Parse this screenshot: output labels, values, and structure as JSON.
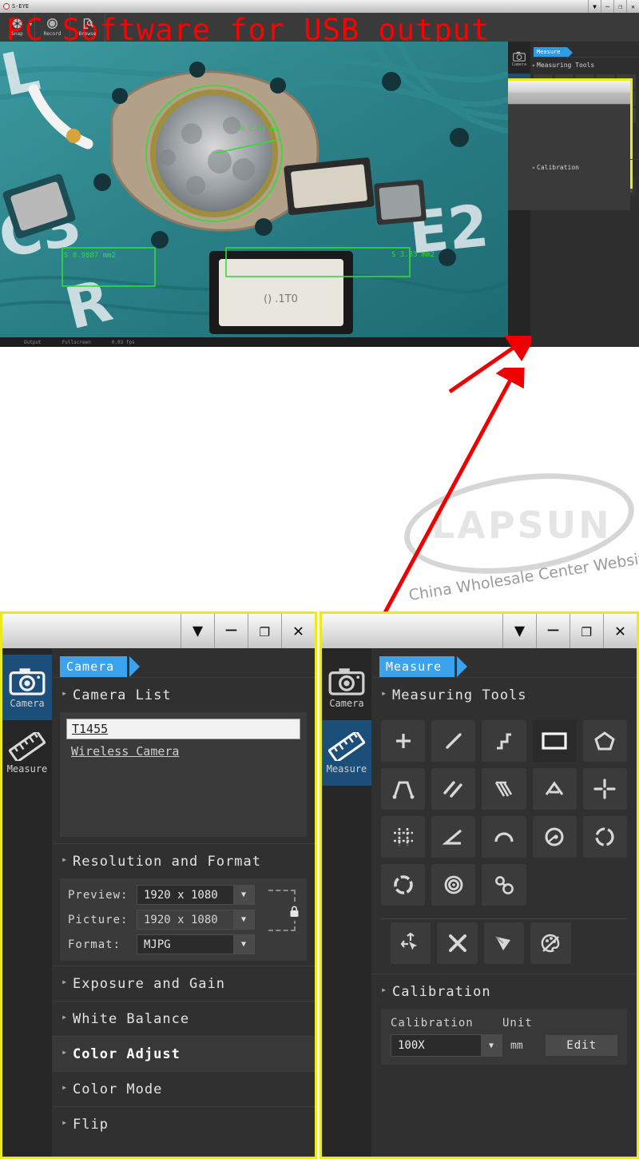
{
  "headline": "PC Software for USB output",
  "app": {
    "name": "S-EYE"
  },
  "top_toolbar": {
    "items": [
      {
        "label": "Snap",
        "icon": "aperture-icon",
        "has_dropdown": true
      },
      {
        "label": "Record",
        "icon": "record-icon",
        "has_dropdown": false
      },
      {
        "label": "Browse",
        "icon": "browse-icon",
        "has_dropdown": false
      }
    ]
  },
  "window_controls": {
    "dropdown": "▼",
    "minimize": "─",
    "restore": "❐",
    "close": "✕"
  },
  "middle_window": {
    "title": "S-EYE",
    "status": {
      "left": "Output",
      "mode": "Fullscreen",
      "fps": "0.03 fps"
    },
    "annotations": [
      {
        "text": "R 1.13 mm",
        "type": "radius"
      },
      {
        "text": "S 0.9887 mm2",
        "type": "area"
      },
      {
        "text": "S 3.83 mm2",
        "type": "area"
      }
    ]
  },
  "watermark": {
    "brand": "LAPSUN",
    "tagline": "China Wholesale Center Website"
  },
  "sidebar": {
    "items": [
      {
        "label": "Camera",
        "icon": "camera-icon"
      },
      {
        "label": "Measure",
        "icon": "ruler-icon"
      }
    ]
  },
  "camera_panel": {
    "tab": "Camera",
    "sections": [
      {
        "label": "Camera List"
      },
      {
        "label": "Resolution and Format"
      },
      {
        "label": "Exposure and Gain"
      },
      {
        "label": "White Balance"
      },
      {
        "label": "Color Adjust"
      },
      {
        "label": "Color Mode"
      },
      {
        "label": "Flip"
      }
    ],
    "camera_list": {
      "selected": "T1455",
      "items": [
        "Wireless Camera"
      ]
    },
    "resolution": {
      "preview_label": "Preview:",
      "preview_value": "1920 x 1080",
      "picture_label": "Picture:",
      "picture_value": "1920 x 1080",
      "format_label": "Format:",
      "format_value": "MJPG",
      "lock_icon": "lock-icon"
    }
  },
  "measure_panel": {
    "tab": "Measure",
    "sections": [
      {
        "label": "Measuring Tools"
      },
      {
        "label": "Calibration"
      }
    ],
    "tools": [
      "point-tool",
      "line-tool",
      "polyline-tool",
      "rectangle-tool",
      "polygon-tool",
      "parallel-distance-tool",
      "parallel-lines-tool",
      "multi-line-tool",
      "angle-vertex-tool",
      "crosshair-tool",
      "grid-tool",
      "angle-tool",
      "arc-tool",
      "circle-center-tool",
      "circle-three-point-tool",
      "closed-curve-tool",
      "concentric-circle-tool",
      "two-circle-distance-tool"
    ],
    "actions": [
      "select-move-tool",
      "delete-tool",
      "clear-all-tool",
      "style-palette-tool"
    ],
    "calibration": {
      "section_label": "Calibration",
      "field_label": "Calibration",
      "unit_label": "Unit",
      "value": "100X",
      "unit_value": "mm",
      "edit_button": "Edit"
    }
  },
  "colors": {
    "accent_blue": "#3aa3ef",
    "border_yellow": "#e8ec1b",
    "headline_red": "#ff0000",
    "panel_dark": "#2e2e2e",
    "arrow_red": "#ee0000",
    "measure_green": "#33dd33"
  }
}
